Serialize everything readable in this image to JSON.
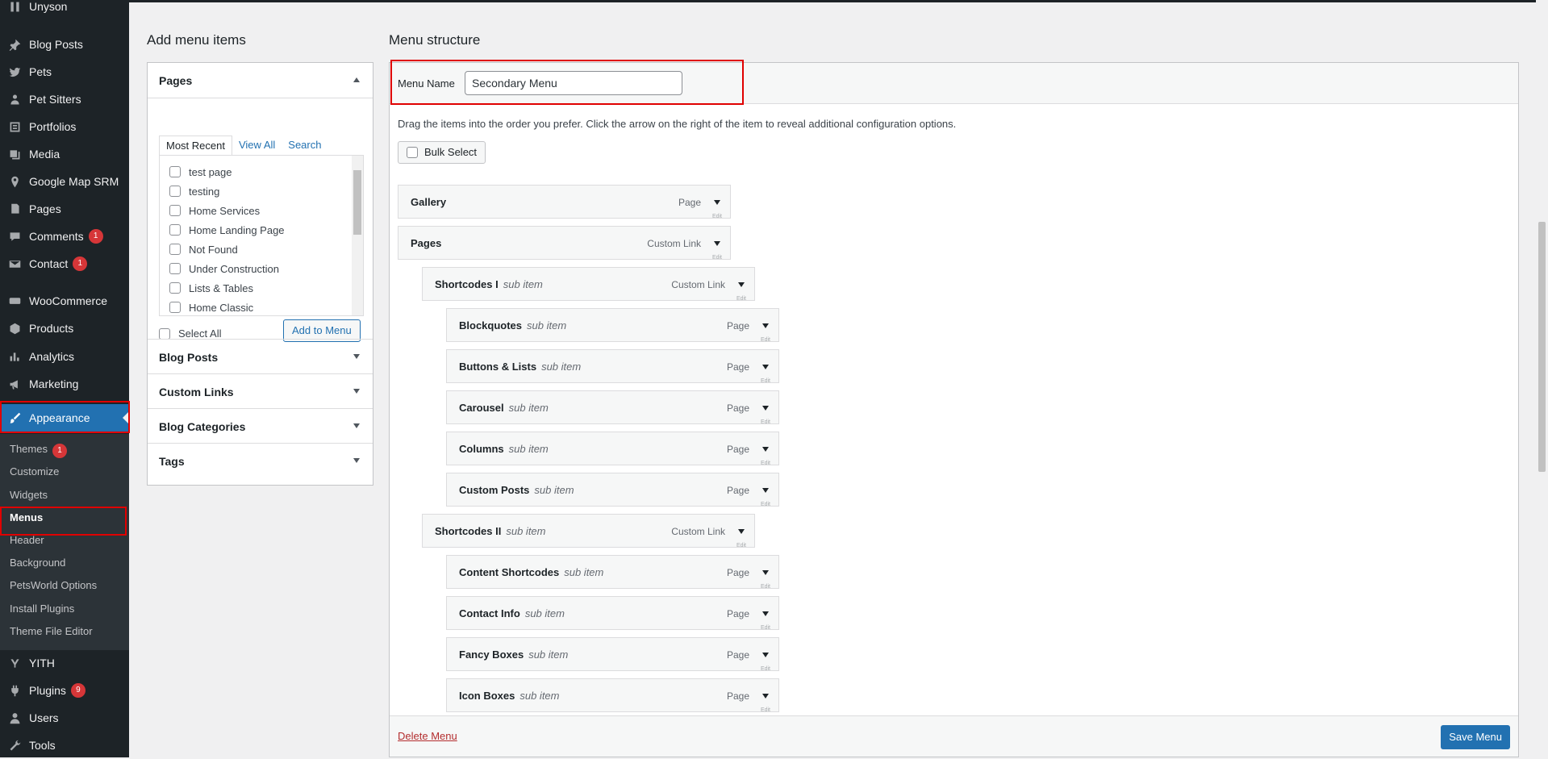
{
  "sidebar": {
    "top_item": "Unyson",
    "items": [
      {
        "label": "Blog Posts",
        "icon": "pin-icon"
      },
      {
        "label": "Pets",
        "icon": "twitter-bird-icon"
      },
      {
        "label": "Pet Sitters",
        "icon": "users-icon"
      },
      {
        "label": "Portfolios",
        "icon": "portfolio-icon"
      },
      {
        "label": "Media",
        "icon": "media-icon"
      },
      {
        "label": "Google Map SRM",
        "icon": "location-pin-icon"
      },
      {
        "label": "Pages",
        "icon": "pages-icon"
      },
      {
        "label": "Comments",
        "icon": "comment-icon",
        "badge": "1"
      },
      {
        "label": "Contact",
        "icon": "envelope-icon",
        "badge": "1"
      },
      {
        "label": "WooCommerce",
        "icon": "woo-icon"
      },
      {
        "label": "Products",
        "icon": "box-icon"
      },
      {
        "label": "Analytics",
        "icon": "bar-chart-icon"
      },
      {
        "label": "Marketing",
        "icon": "megaphone-icon"
      },
      {
        "label": "Appearance",
        "icon": "paintbrush-icon"
      }
    ],
    "submenu": [
      {
        "label": "Themes",
        "badge": "1"
      },
      {
        "label": "Customize"
      },
      {
        "label": "Widgets"
      },
      {
        "label": "Menus"
      },
      {
        "label": "Header"
      },
      {
        "label": "Background"
      },
      {
        "label": "PetsWorld Options"
      },
      {
        "label": "Install Plugins"
      },
      {
        "label": "Theme File Editor"
      }
    ],
    "bottom_items": [
      {
        "label": "YITH",
        "icon": "yith-icon"
      },
      {
        "label": "Plugins",
        "icon": "plugin-icon",
        "badge": "9"
      },
      {
        "label": "Users",
        "icon": "user-icon"
      },
      {
        "label": "Tools",
        "icon": "wrench-icon"
      }
    ]
  },
  "left": {
    "heading": "Add menu items",
    "pages_panel": {
      "title": "Pages",
      "tabs": [
        "Most Recent",
        "View All",
        "Search"
      ],
      "pages": [
        "test page",
        "testing",
        "Home Services",
        "Home Landing Page",
        "Not Found",
        "Under Construction",
        "Lists & Tables",
        "Home Classic"
      ],
      "select_all": "Select All",
      "add_button": "Add to Menu"
    },
    "collapsed_panels": [
      "Blog Posts",
      "Custom Links",
      "Blog Categories",
      "Tags"
    ]
  },
  "right": {
    "heading": "Menu structure",
    "menu_name_label": "Menu Name",
    "menu_name_value": "Secondary Menu",
    "instructions": "Drag the items into the order you prefer. Click the arrow on the right of the item to reveal additional configuration options.",
    "bulk_select": "Bulk Select",
    "sub_item_label": "sub item",
    "edit_label": "Edit",
    "items": [
      {
        "title": "Gallery",
        "type": "Page",
        "depth": 0,
        "sub": false
      },
      {
        "title": "Pages",
        "type": "Custom Link",
        "depth": 0,
        "sub": false
      },
      {
        "title": "Shortcodes I",
        "type": "Custom Link",
        "depth": 1,
        "sub": true
      },
      {
        "title": "Blockquotes",
        "type": "Page",
        "depth": 2,
        "sub": true
      },
      {
        "title": "Buttons & Lists",
        "type": "Page",
        "depth": 2,
        "sub": true
      },
      {
        "title": "Carousel",
        "type": "Page",
        "depth": 2,
        "sub": true
      },
      {
        "title": "Columns",
        "type": "Page",
        "depth": 2,
        "sub": true
      },
      {
        "title": "Custom Posts",
        "type": "Page",
        "depth": 2,
        "sub": true
      },
      {
        "title": "Shortcodes II",
        "type": "Custom Link",
        "depth": 1,
        "sub": true
      },
      {
        "title": "Content Shortcodes",
        "type": "Page",
        "depth": 2,
        "sub": true
      },
      {
        "title": "Contact Info",
        "type": "Page",
        "depth": 2,
        "sub": true
      },
      {
        "title": "Fancy Boxes",
        "type": "Page",
        "depth": 2,
        "sub": true
      },
      {
        "title": "Icon Boxes",
        "type": "Page",
        "depth": 2,
        "sub": true
      }
    ],
    "delete_menu": "Delete Menu",
    "save_menu": "Save Menu"
  },
  "colors": {
    "admin_dark": "#1d2327",
    "accent": "#2271b1",
    "badge": "#d63638",
    "highlight_box": "#e00000"
  }
}
